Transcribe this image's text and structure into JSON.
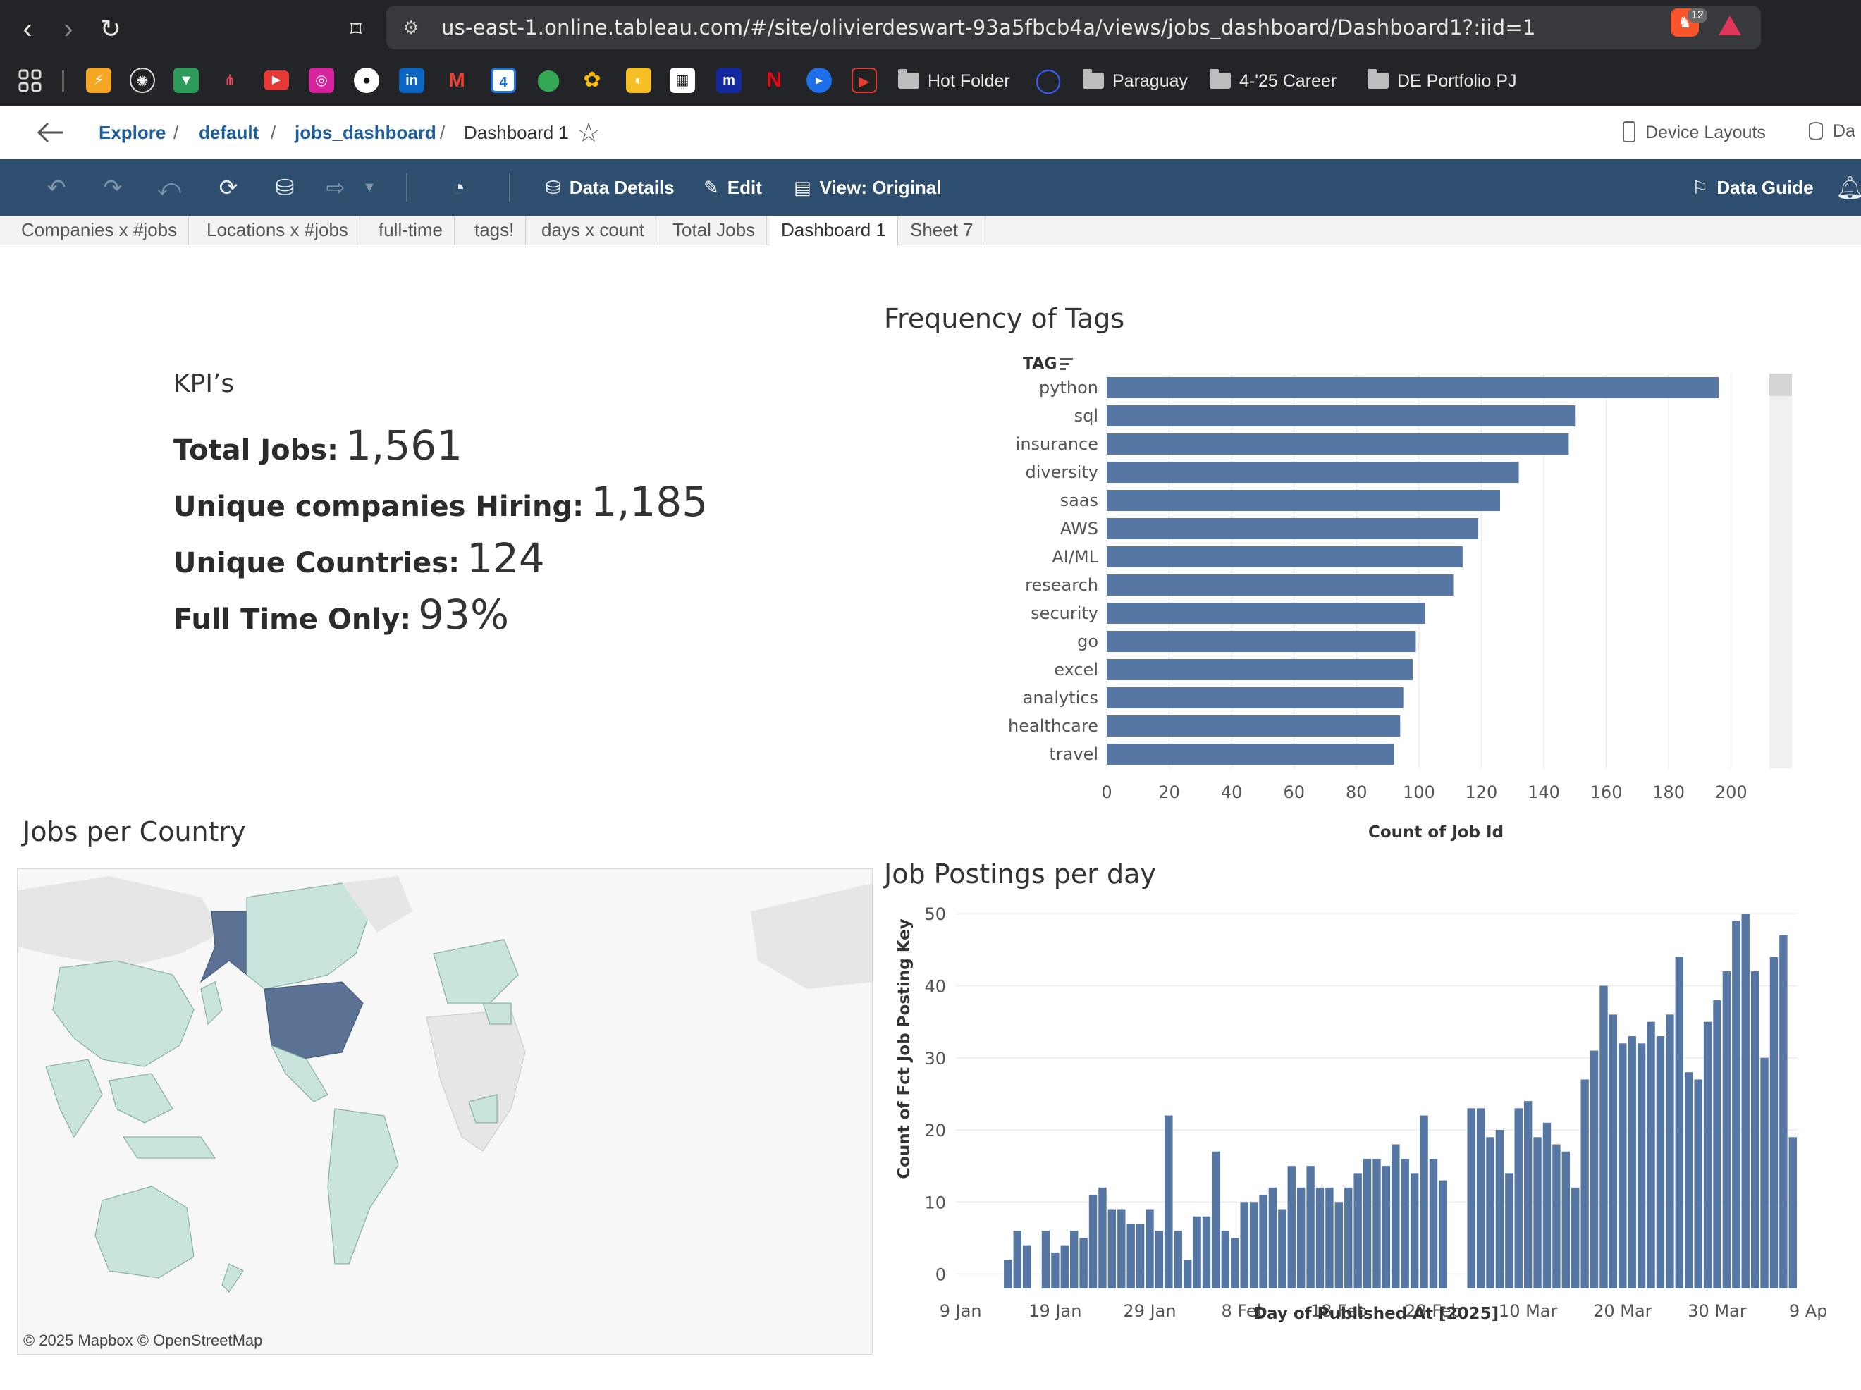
{
  "browser": {
    "url": "us-east-1.online.tableau.com/#/site/olivierdeswart-93a5fbcb4a/views/jobs_dashboard/Dashboard1?:iid=1",
    "brave_badge": "12",
    "bookmarks": [
      {
        "icon": "apps-grid-icon"
      },
      {
        "icon": "lightning-icon",
        "color": "#f5a623"
      },
      {
        "icon": "openai-icon",
        "color": "#444444"
      },
      {
        "icon": "bookmark-icon",
        "color": "#2e9b5a"
      },
      {
        "icon": "share-icon",
        "color": "#e0455a"
      },
      {
        "icon": "youtube-icon",
        "color": "#e53935"
      },
      {
        "icon": "instagram-icon",
        "color": "#d6249f"
      },
      {
        "icon": "github-icon",
        "color": "#333333"
      },
      {
        "icon": "linkedin-icon",
        "color": "#0a66c2"
      },
      {
        "icon": "gmail-icon",
        "color": "#ea4335"
      },
      {
        "icon": "calendar-icon",
        "color": "#1a73e8"
      },
      {
        "icon": "maps-icon",
        "color": "#34a853"
      },
      {
        "icon": "photos-icon",
        "color": "#fbbc04"
      },
      {
        "icon": "keep-icon",
        "color": "#f6bf26"
      },
      {
        "icon": "qr-icon",
        "color": "#333333"
      },
      {
        "icon": "meetup-icon",
        "color": "#1428a0"
      },
      {
        "icon": "netflix-icon",
        "color": "#e50914"
      },
      {
        "icon": "play-icon",
        "color": "#1f6feb"
      },
      {
        "icon": "video-icon",
        "color": "#e53935"
      }
    ],
    "folders": [
      {
        "label": "Hot Folder"
      },
      {
        "label": "Paraguay"
      },
      {
        "label": "4-'25 Career"
      },
      {
        "label": "DE Portfolio PJ"
      }
    ]
  },
  "header": {
    "breadcrumbs": [
      "Explore",
      "default",
      "jobs_dashboard",
      "Dashboard 1"
    ],
    "device_layouts": "Device Layouts",
    "data_source_partial": "Da"
  },
  "toolbar": {
    "data_details": "Data Details",
    "edit": "Edit",
    "view": "View: Original",
    "data_guide": "Data Guide"
  },
  "tabs": [
    "Companies x #jobs",
    "Locations x #jobs",
    "full-time",
    "tags!",
    "days x count",
    "Total Jobs",
    "Dashboard 1",
    "Sheet 7"
  ],
  "active_tab": "Dashboard 1",
  "kpi": {
    "title": "KPI’s",
    "rows": [
      {
        "label": "Total Jobs:",
        "value": "1,561"
      },
      {
        "label": "Unique companies Hiring:",
        "value": "1,185"
      },
      {
        "label": "Unique Countries:",
        "value": "124"
      },
      {
        "label": "Full Time Only:",
        "value": "93%"
      }
    ]
  },
  "tags_chart": {
    "title": "Frequency of Tags",
    "field_label": "TAG",
    "color": "#5677a4"
  },
  "map": {
    "title": "Jobs per Country",
    "attribution": "© 2025 Mapbox  © OpenStreetMap",
    "high_color": "#5b7294",
    "low_color": "#c8e4dc",
    "none_color": "#e3e3e3"
  },
  "postings_chart": {
    "title": "Job Postings per day",
    "color": "#5677a4"
  },
  "chart_data": [
    {
      "type": "bar",
      "orientation": "horizontal",
      "title": "Frequency of Tags",
      "xlabel": "Count of Job Id",
      "ylabel": "TAG",
      "categories": [
        "python",
        "sql",
        "insurance",
        "diversity",
        "saas",
        "AWS",
        "AI/ML",
        "research",
        "security",
        "go",
        "excel",
        "analytics",
        "healthcare",
        "travel"
      ],
      "values": [
        196,
        150,
        148,
        132,
        126,
        119,
        114,
        111,
        102,
        99,
        98,
        95,
        94,
        92
      ],
      "xlim": [
        0,
        210
      ],
      "xticks": [
        0,
        20,
        40,
        60,
        80,
        100,
        120,
        140,
        160,
        180,
        200
      ],
      "grid": true
    },
    {
      "type": "bar",
      "title": "Job Postings per day",
      "xlabel": "Day of Published At [2025]",
      "ylabel": "Count of Fct Job Posting Key",
      "x_start": "2025-01-09",
      "xtick_labels": [
        "9 Jan",
        "19 Jan",
        "29 Jan",
        "8 Feb",
        "18 Feb",
        "28 Feb",
        "10 Mar",
        "20 Mar",
        "30 Mar",
        "9 Apr"
      ],
      "xticks": [
        "2025-01-09",
        "2025-01-19",
        "2025-01-29",
        "2025-02-08",
        "2025-02-18",
        "2025-02-28",
        "2025-03-10",
        "2025-03-20",
        "2025-03-30",
        "2025-04-09"
      ],
      "yticks": [
        0,
        10,
        20,
        30,
        40,
        50
      ],
      "ylim": [
        -2,
        51
      ],
      "values": [
        0,
        0,
        0,
        0,
        0,
        2,
        6,
        4,
        0,
        6,
        3,
        4,
        6,
        5,
        11,
        12,
        9,
        9,
        7,
        7,
        9,
        6,
        22,
        6,
        2,
        8,
        8,
        17,
        6,
        5,
        10,
        10,
        11,
        12,
        9,
        15,
        12,
        15,
        12,
        12,
        10,
        12,
        14,
        16,
        16,
        15,
        18,
        16,
        14,
        22,
        16,
        13,
        0,
        0,
        23,
        23,
        19,
        20,
        14,
        23,
        24,
        19,
        21,
        18,
        17,
        12,
        27,
        31,
        40,
        36,
        32,
        33,
        32,
        35,
        33,
        36,
        44,
        28,
        27,
        35,
        38,
        42,
        49,
        50,
        42,
        30,
        44,
        47,
        19
      ]
    }
  ]
}
